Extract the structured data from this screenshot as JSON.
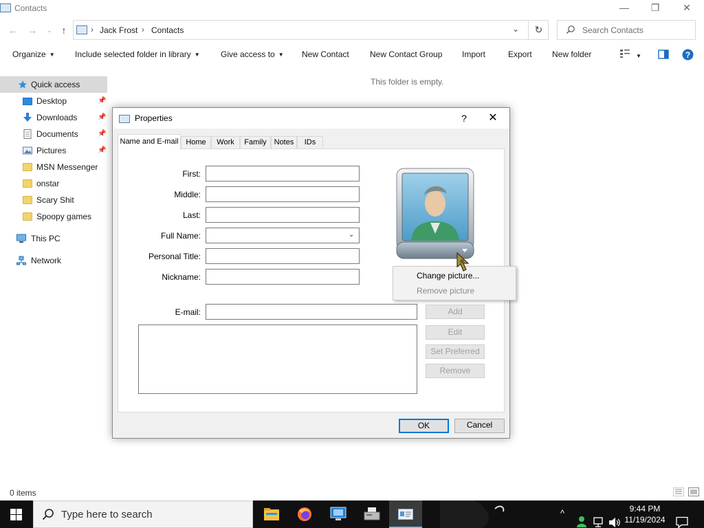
{
  "window": {
    "title": "Contacts",
    "minimize_glyph": "—",
    "restore_glyph": "❐",
    "close_glyph": "✕"
  },
  "address": {
    "breadcrumbs": [
      "Jack Frost",
      "Contacts"
    ],
    "search_placeholder": "Search Contacts"
  },
  "toolbar": {
    "organize": "Organize",
    "include_library": "Include selected folder in library",
    "give_access": "Give access to",
    "new_contact": "New Contact",
    "new_contact_group": "New Contact Group",
    "import": "Import",
    "export": "Export",
    "new_folder": "New folder"
  },
  "nav": {
    "quick_access": "Quick access",
    "items": [
      "Desktop",
      "Downloads",
      "Documents",
      "Pictures",
      "MSN Messenger",
      "onstar",
      "Scary Shit",
      "Spoopy games"
    ],
    "this_pc": "This PC",
    "network": "Network"
  },
  "content": {
    "empty_message": "This folder is empty."
  },
  "status": {
    "item_count": "0 items"
  },
  "dialog": {
    "title": "Properties",
    "help_glyph": "?",
    "close_glyph": "✕",
    "tabs": [
      "Name and E-mail",
      "Home",
      "Work",
      "Family",
      "Notes",
      "IDs"
    ],
    "labels": {
      "first": "First:",
      "middle": "Middle:",
      "last": "Last:",
      "full_name": "Full Name:",
      "personal_title": "Personal Title:",
      "nickname": "Nickname:",
      "email": "E-mail:"
    },
    "values": {
      "first": "",
      "middle": "",
      "last": "",
      "full_name": "",
      "personal_title": "",
      "nickname": "",
      "email": ""
    },
    "email_buttons": {
      "add": "Add",
      "edit": "Edit",
      "set_preferred": "Set Preferred",
      "remove": "Remove"
    },
    "picture_menu": {
      "change": "Change picture...",
      "remove": "Remove picture"
    },
    "ok": "OK",
    "cancel": "Cancel"
  },
  "taskbar": {
    "search_placeholder": "Type here to search",
    "time": "9:44 PM",
    "date": "11/19/2024"
  },
  "colors": {
    "accent": "#0078d7",
    "selection": "#cce8ff",
    "taskbar": "#101010"
  }
}
